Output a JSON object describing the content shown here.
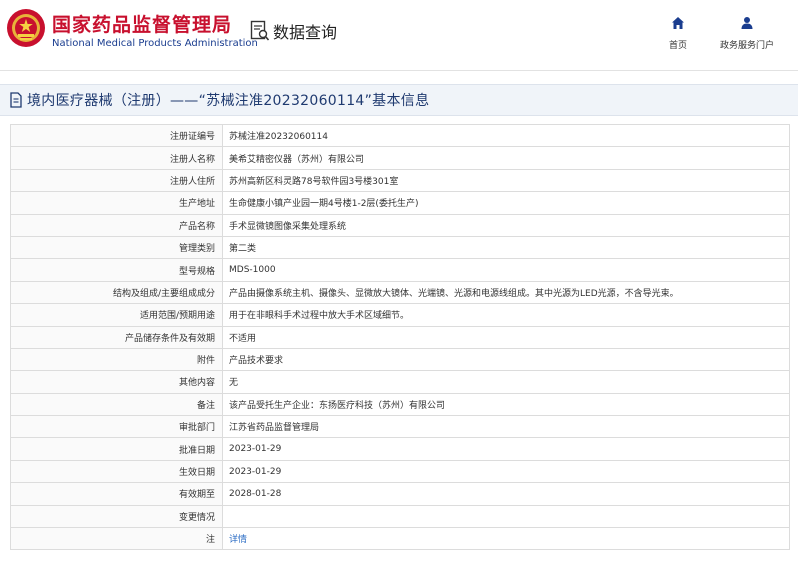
{
  "header": {
    "org_name_cn": "国家药品监督管理局",
    "org_name_en": "National Medical Products Administration",
    "query_label": "数据查询",
    "nav": [
      {
        "label": "首页",
        "icon": "home-icon"
      },
      {
        "label": "政务服务门户",
        "icon": "user-icon"
      }
    ]
  },
  "title": "境内医疗器械（注册）——“苏械注准20232060114”基本信息",
  "rows": [
    {
      "label": "注册证编号",
      "value": "苏械注准20232060114"
    },
    {
      "label": "注册人名称",
      "value": "美希艾精密仪器（苏州）有限公司"
    },
    {
      "label": "注册人住所",
      "value": "苏州高新区科灵路78号软件园3号楼301室"
    },
    {
      "label": "生产地址",
      "value": "生命健康小镇产业园一期4号楼1-2层(委托生产)"
    },
    {
      "label": "产品名称",
      "value": "手术显微镜图像采集处理系统"
    },
    {
      "label": "管理类别",
      "value": "第二类"
    },
    {
      "label": "型号规格",
      "value": "MDS-1000"
    },
    {
      "label": "结构及组成/主要组成成分",
      "value": "产品由摄像系统主机、摄像头、显微放大镜体、光端镜、光源和电源线组成。其中光源为LED光源，不含导光束。"
    },
    {
      "label": "适用范围/预期用途",
      "value": "用于在非眼科手术过程中放大手术区域细节。"
    },
    {
      "label": "产品储存条件及有效期",
      "value": "不适用"
    },
    {
      "label": "附件",
      "value": "产品技术要求"
    },
    {
      "label": "其他内容",
      "value": "无"
    },
    {
      "label": "备注",
      "value": "该产品受托生产企业：东扬医疗科技（苏州）有限公司"
    },
    {
      "label": "审批部门",
      "value": "江苏省药品监督管理局"
    },
    {
      "label": "批准日期",
      "value": "2023-01-29"
    },
    {
      "label": "生效日期",
      "value": "2023-01-29"
    },
    {
      "label": "有效期至",
      "value": "2028-01-28"
    },
    {
      "label": "变更情况",
      "value": ""
    },
    {
      "label": "注",
      "value": "详情",
      "is_link": true
    }
  ],
  "colors": {
    "brand_red": "#c8102e",
    "brand_blue": "#1a3d8f",
    "title_text": "#1f3a70",
    "link": "#2b6cc4"
  }
}
